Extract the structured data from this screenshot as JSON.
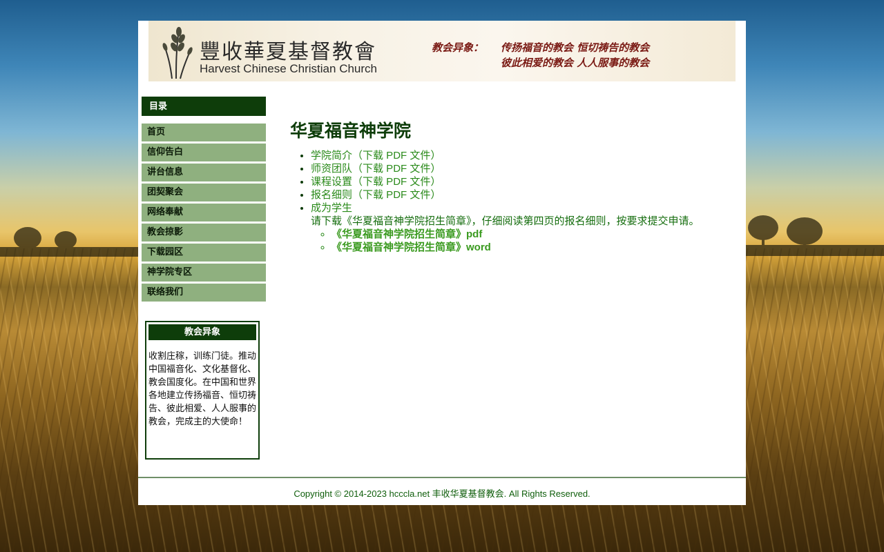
{
  "header": {
    "church_name_cn": "豐收華夏基督教會",
    "church_name_en": "Harvest Chinese Christian Church",
    "vision_label": "教会异象：",
    "vision_line_1": "传扬福音的教会  恒切祷告的教会",
    "vision_line_2": "彼此相爱的教会  人人服事的教会"
  },
  "sidebar": {
    "menu_title": "目录",
    "items": [
      {
        "label": "首页"
      },
      {
        "label": "信仰告白"
      },
      {
        "label": "讲台信息"
      },
      {
        "label": "团契聚会"
      },
      {
        "label": "网络奉献"
      },
      {
        "label": "教会掠影"
      },
      {
        "label": "下载园区"
      },
      {
        "label": "神学院专区"
      },
      {
        "label": "联络我们"
      }
    ],
    "vision_box": {
      "title": "教会异象",
      "text": "收割庄稼，训练门徒。推动中国福音化、文化基督化、教会国度化。在中国和世界各地建立传扬福音、恒切祷告、彼此相爱、人人服事的教会，完成主的大使命！"
    }
  },
  "main": {
    "title": "华夏福音神学院",
    "items": [
      {
        "label": "学院简介",
        "download": "（下载 PDF 文件）"
      },
      {
        "label": "师资团队",
        "download": "（下载 PDF 文件）"
      },
      {
        "label": "课程设置",
        "download": "（下载 PDF 文件）"
      },
      {
        "label": "报名细则",
        "download": "（下载 PDF 文件）"
      }
    ],
    "become_student": {
      "label": "成为学生",
      "note": "请下载《华夏福音神学院招生简章》，仔细阅读第四页的报名细则，按要求提交申请。",
      "links": [
        {
          "label": "《华夏福音神学院招生简章》pdf"
        },
        {
          "label": "《华夏福音神学院招生简章》word"
        }
      ]
    }
  },
  "footer": {
    "copyright": "Copyright © 2014-2023  hcccla.net 丰收华夏基督教会. All Rights Reserved."
  },
  "colors": {
    "dark_green": "#0e3d0a",
    "menu_green": "#8fb07f",
    "link_green": "#2a8a1a",
    "banner_red": "#7a1a14"
  }
}
